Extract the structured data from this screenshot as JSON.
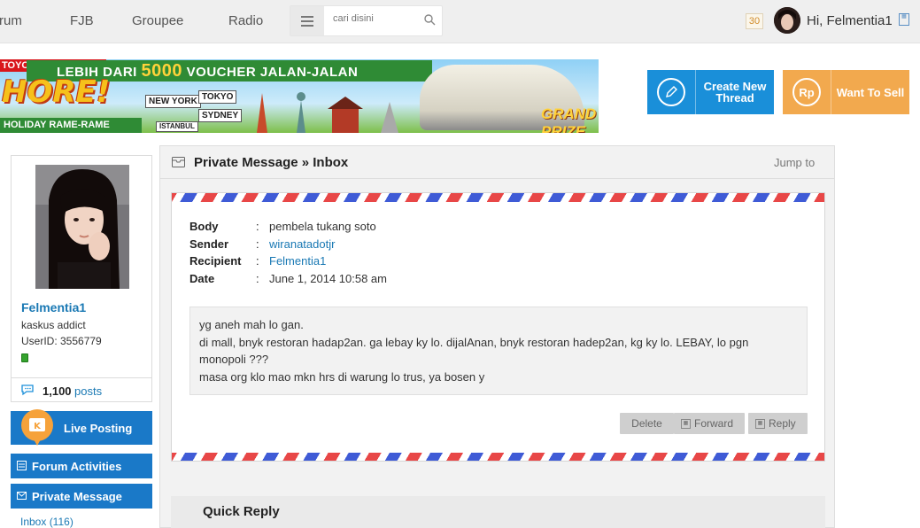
{
  "nav": {
    "items": [
      "rum",
      "FJB",
      "Groupee",
      "Radio"
    ],
    "search_placeholder": "cari disini",
    "notifications": "30",
    "greeting": "Hi, Felmentia1"
  },
  "banner": {
    "brand": "TOYOTA",
    "headline": "HORE!",
    "strip_prefix": "LEBIH DARI ",
    "strip_number": "5000",
    "strip_suffix": " VOUCHER JALAN-JALAN",
    "footer": "HOLIDAY RAME-RAME",
    "signs": [
      "NEW YORK",
      "TOKYO",
      "SYDNEY",
      "ISTANBUL"
    ],
    "badge": "GRAND PRIZE"
  },
  "actions_top": {
    "create_thread": "Create New Thread",
    "want_to_sell": "Want To Sell",
    "rp_symbol": "Rp"
  },
  "profile": {
    "name": "Felmentia1",
    "rank": "kaskus addict",
    "user_id": "UserID: 3556779",
    "posts_count": "1,100",
    "posts_label": "posts"
  },
  "sidebar": {
    "live_posting": "Live Posting",
    "forum_activities": "Forum Activities",
    "private_message": "Private Message",
    "inbox": "Inbox (116)"
  },
  "pm": {
    "title": "Private Message » Inbox",
    "jump_to": "Jump to",
    "labels": {
      "body": "Body",
      "sender": "Sender",
      "recipient": "Recipient",
      "date": "Date"
    },
    "body": "pembela tukang soto",
    "sender": "wiranatadotjr",
    "recipient": "Felmentia1",
    "date": "June 1, 2014 10:58 am",
    "message_lines": [
      "yg aneh mah lo gan.",
      "di mall, bnyk restoran hadap2an. ga lebay ky lo. dijalAnan, bnyk restoran hadep2an, kg ky lo. LEBAY, lo pgn monopoli ???",
      "masa org klo mao mkn hrs di warung lo trus, ya bosen y"
    ],
    "delete": "Delete",
    "forward": "Forward",
    "reply": "Reply",
    "quick_reply": "Quick Reply"
  },
  "colors": {
    "blue": "#1a79c8",
    "orange": "#f2a94e",
    "link": "#1a79b4",
    "airmail_red": "#e84747",
    "airmail_blue": "#3f5bd6"
  }
}
